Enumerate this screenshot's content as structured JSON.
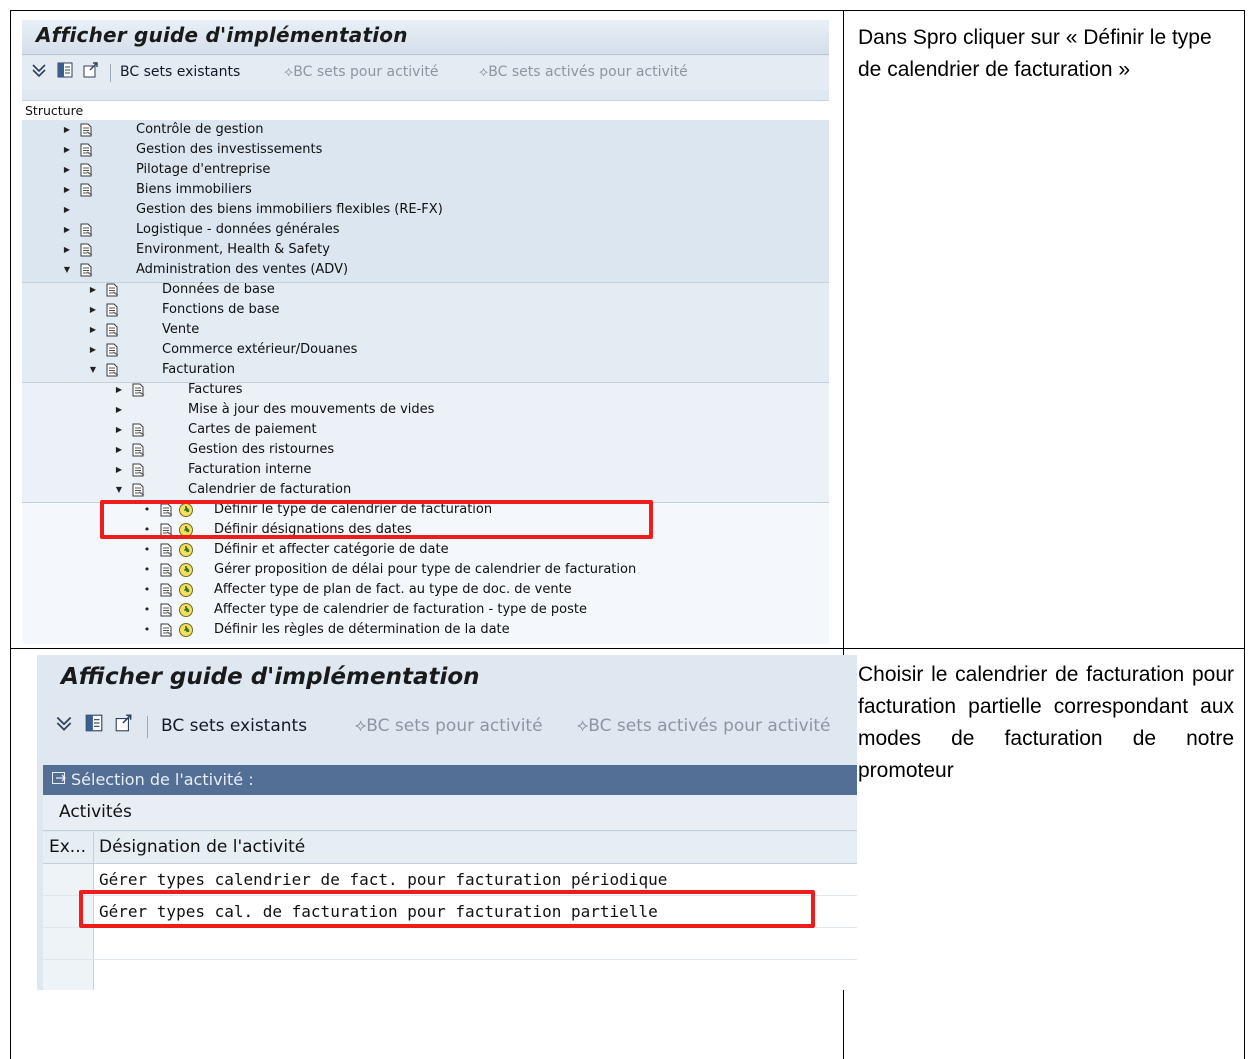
{
  "row1": {
    "instruction": "Dans Spro cliquer sur « Définir le type de calendrier de facturation »",
    "screenshot": {
      "title": "Afficher guide d'implémentation",
      "toolbar": {
        "bc_sets_existants": "BC sets existants",
        "bc_sets_activite": "BC sets pour activité",
        "bc_sets_actives": "BC sets activés pour activité"
      },
      "tree_header": "Structure",
      "items": [
        {
          "label": "Contrôle de gestion"
        },
        {
          "label": "Gestion des investissements"
        },
        {
          "label": "Pilotage d'entreprise"
        },
        {
          "label": "Biens immobiliers"
        },
        {
          "label": "Gestion des biens immobiliers flexibles (RE-FX)"
        },
        {
          "label": "Logistique - données générales"
        },
        {
          "label": "Environment, Health & Safety"
        },
        {
          "label": "Administration des ventes (ADV)"
        },
        {
          "label": "Données de base"
        },
        {
          "label": "Fonctions de base"
        },
        {
          "label": "Vente"
        },
        {
          "label": "Commerce extérieur/Douanes"
        },
        {
          "label": "Facturation"
        },
        {
          "label": "Factures"
        },
        {
          "label": "Mise à jour des mouvements de vides"
        },
        {
          "label": "Cartes de paiement"
        },
        {
          "label": "Gestion des ristournes"
        },
        {
          "label": "Facturation interne"
        },
        {
          "label": "Calendrier de facturation"
        },
        {
          "label": "Définir le type de calendrier de facturation"
        },
        {
          "label": "Définir désignations des dates"
        },
        {
          "label": "Définir et affecter catégorie de date"
        },
        {
          "label": "Gérer proposition de délai pour type de calendrier de facturation"
        },
        {
          "label": "Affecter type de plan de fact. au type de doc. de vente"
        },
        {
          "label": "Affecter type de calendrier de facturation - type de poste"
        },
        {
          "label": "Définir les règles de détermination de la date"
        }
      ]
    }
  },
  "row2": {
    "instruction": "Choisir le calendrier de facturation pour facturation partielle correspondant aux modes de facturation de notre promoteur",
    "screenshot": {
      "title": "Afficher guide d'implémentation",
      "toolbar": {
        "bc_sets_existants": "BC sets existants",
        "bc_sets_activite": "BC sets pour activité",
        "bc_sets_actives": "BC sets activés pour activité"
      },
      "selection_title": "Sélection de l'activité :",
      "section_header": "Activités",
      "col_ex": "Ex...",
      "col_designation": "Désignation de l'activité",
      "rows": [
        "Gérer types calendrier de fact. pour facturation périodique",
        "Gérer types cal. de facturation pour facturation partielle"
      ]
    }
  },
  "colors": {
    "highlight": "#ef1c1c",
    "sap_panel": "#dfe8f1",
    "selection_bar": "#546f95"
  }
}
